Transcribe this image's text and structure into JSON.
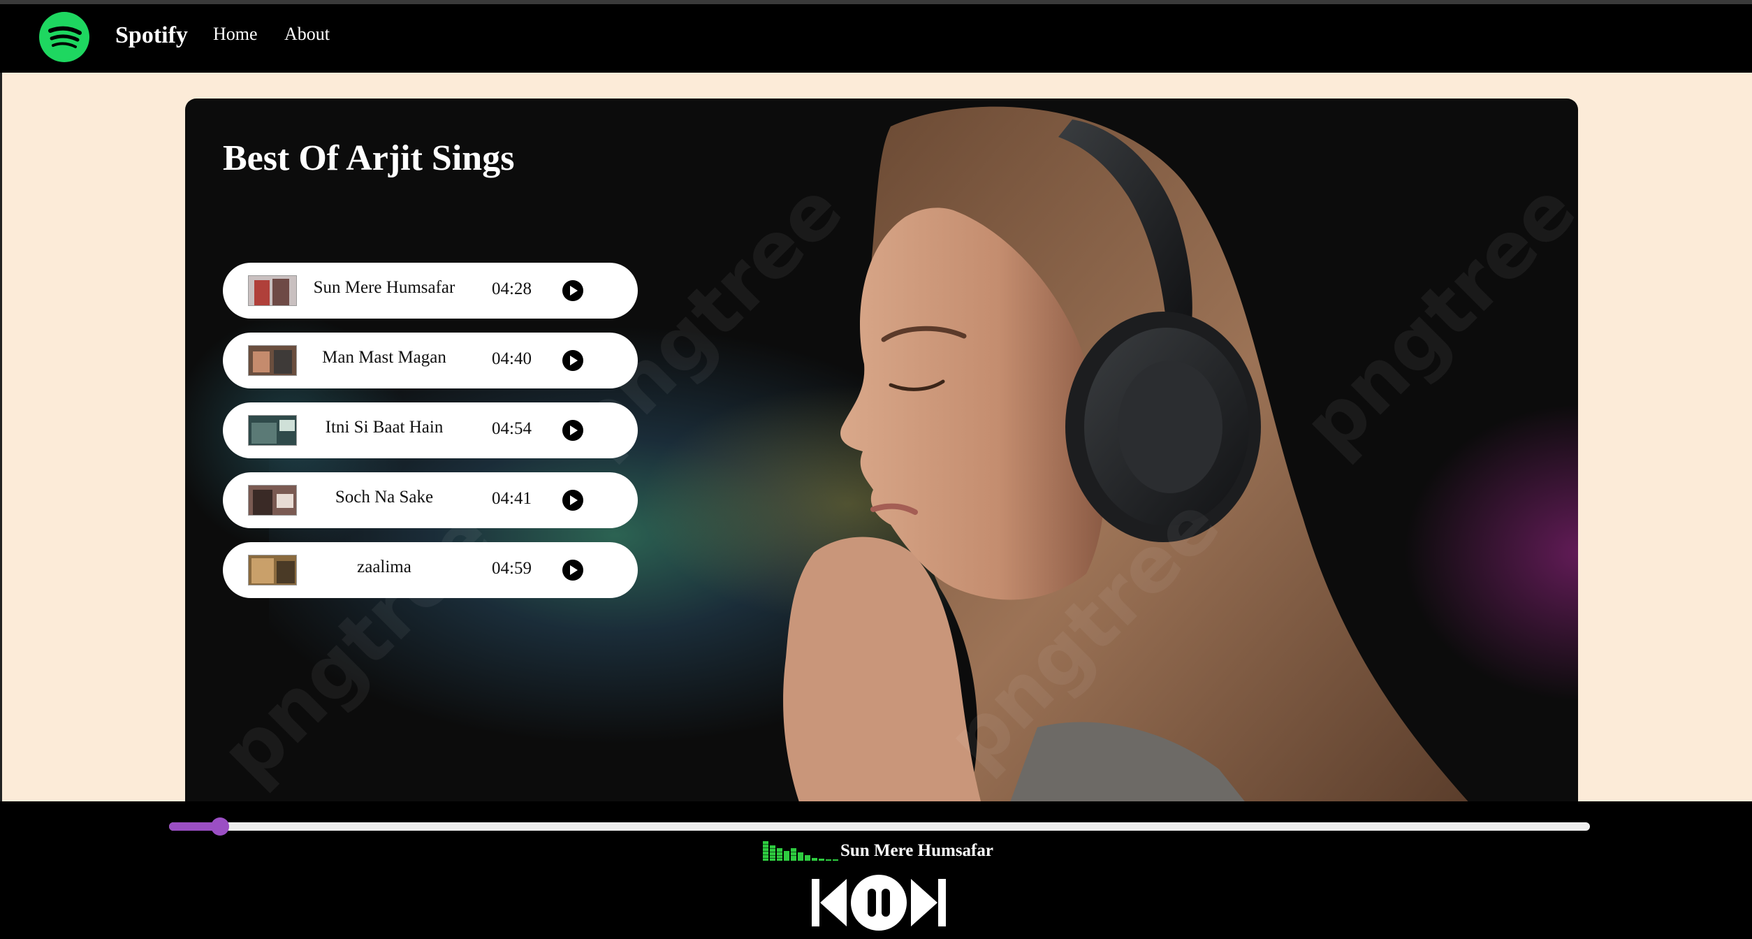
{
  "nav": {
    "brand": "Spotify",
    "links": [
      "Home",
      "About"
    ]
  },
  "hero": {
    "title": "Best Of Arjit Sings",
    "watermark": "pngtree"
  },
  "songs": [
    {
      "name": "Sun Mere Humsafar",
      "duration": "04:28"
    },
    {
      "name": "Man Mast Magan",
      "duration": "04:40"
    },
    {
      "name": "Itni Si Baat Hain",
      "duration": "04:54"
    },
    {
      "name": "Soch Na Sake",
      "duration": "04:41"
    },
    {
      "name": "zaalima",
      "duration": "04:59"
    }
  ],
  "player": {
    "now_playing": "Sun Mere Humsafar",
    "progress_percent": 3.6,
    "colors": {
      "accent": "#9b4fc4",
      "equalizer": "#2ecc40",
      "brand": "#1ed760"
    },
    "icons": [
      "previous-icon",
      "pause-icon",
      "next-icon"
    ]
  }
}
